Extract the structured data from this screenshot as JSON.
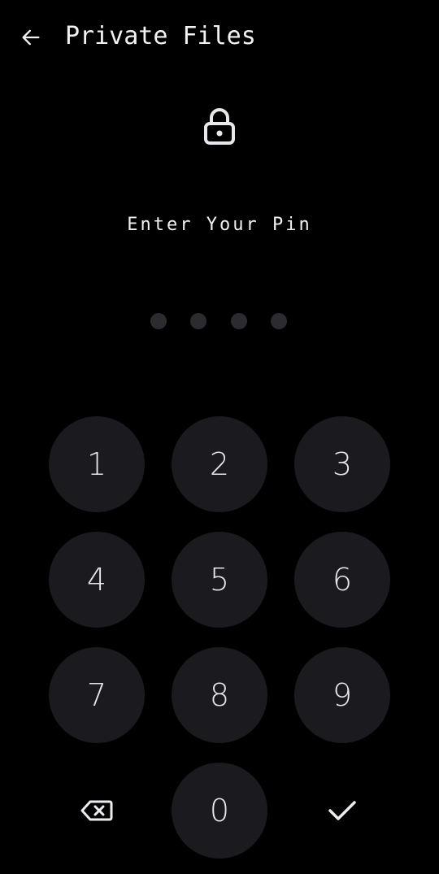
{
  "header": {
    "back_icon": "arrow-left-icon",
    "title": "Private Files"
  },
  "lock": {
    "icon": "lock-icon"
  },
  "prompt": "Enter Your Pin",
  "pin": {
    "length": 4,
    "entered": 0
  },
  "keypad": {
    "keys": [
      "1",
      "2",
      "3",
      "4",
      "5",
      "6",
      "7",
      "8",
      "9",
      "0"
    ],
    "backspace_icon": "backspace-icon",
    "confirm_icon": "check-icon"
  },
  "colors": {
    "background": "#000000",
    "key_background": "#1b1b1f",
    "dot": "#2c2c30",
    "text": "#ececf0"
  }
}
